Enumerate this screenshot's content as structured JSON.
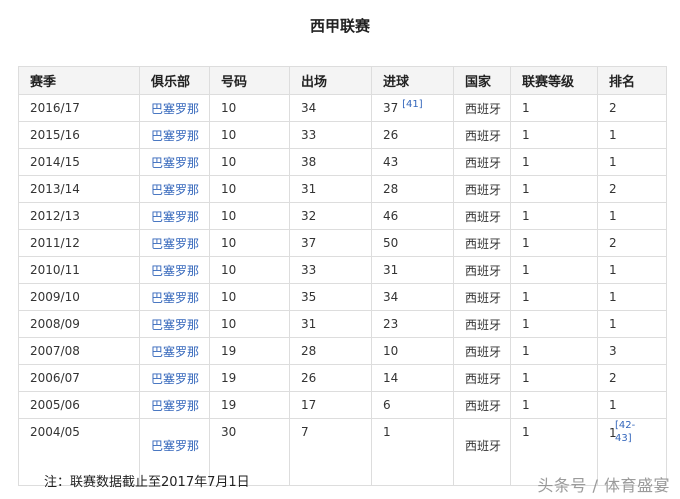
{
  "title": "西甲联赛",
  "table": {
    "headers": [
      "赛季",
      "俱乐部",
      "号码",
      "出场",
      "进球",
      "国家",
      "联赛等级",
      "排名"
    ],
    "rows": [
      {
        "season": "2016/17",
        "club": "巴塞罗那",
        "number": "10",
        "apps": "34",
        "goals": "37",
        "goals_ref": "[41]",
        "country": "西班牙",
        "level": "1",
        "rank": "2"
      },
      {
        "season": "2015/16",
        "club": "巴塞罗那",
        "number": "10",
        "apps": "33",
        "goals": "26",
        "country": "西班牙",
        "level": "1",
        "rank": "1"
      },
      {
        "season": "2014/15",
        "club": "巴塞罗那",
        "number": "10",
        "apps": "38",
        "goals": "43",
        "country": "西班牙",
        "level": "1",
        "rank": "1"
      },
      {
        "season": "2013/14",
        "club": "巴塞罗那",
        "number": "10",
        "apps": "31",
        "goals": "28",
        "country": "西班牙",
        "level": "1",
        "rank": "2"
      },
      {
        "season": "2012/13",
        "club": "巴塞罗那",
        "number": "10",
        "apps": "32",
        "goals": "46",
        "country": "西班牙",
        "level": "1",
        "rank": "1"
      },
      {
        "season": "2011/12",
        "club": "巴塞罗那",
        "number": "10",
        "apps": "37",
        "goals": "50",
        "country": "西班牙",
        "level": "1",
        "rank": "2"
      },
      {
        "season": "2010/11",
        "club": "巴塞罗那",
        "number": "10",
        "apps": "33",
        "goals": "31",
        "country": "西班牙",
        "level": "1",
        "rank": "1"
      },
      {
        "season": "2009/10",
        "club": "巴塞罗那",
        "number": "10",
        "apps": "35",
        "goals": "34",
        "country": "西班牙",
        "level": "1",
        "rank": "1"
      },
      {
        "season": "2008/09",
        "club": "巴塞罗那",
        "number": "10",
        "apps": "31",
        "goals": "23",
        "country": "西班牙",
        "level": "1",
        "rank": "1"
      },
      {
        "season": "2007/08",
        "club": "巴塞罗那",
        "number": "19",
        "apps": "28",
        "goals": "10",
        "country": "西班牙",
        "level": "1",
        "rank": "3"
      },
      {
        "season": "2006/07",
        "club": "巴塞罗那",
        "number": "19",
        "apps": "26",
        "goals": "14",
        "country": "西班牙",
        "level": "1",
        "rank": "2"
      },
      {
        "season": "2005/06",
        "club": "巴塞罗那",
        "number": "19",
        "apps": "17",
        "goals": "6",
        "country": "西班牙",
        "level": "1",
        "rank": "1"
      },
      {
        "season": "2004/05",
        "club": "巴塞罗那",
        "number": "30",
        "apps": "7",
        "goals": "1",
        "country": "西班牙",
        "level": "1",
        "rank": "1",
        "rank_ref_line1": "[42-",
        "rank_ref_line2": "43]"
      }
    ]
  },
  "note": "注：联赛数据截止至2017年7月1日",
  "watermark": "头条号 / 体育盛宴",
  "colors": {
    "link": "#3366bb",
    "header_bg": "#f4f4f4",
    "border": "#dddddd"
  }
}
